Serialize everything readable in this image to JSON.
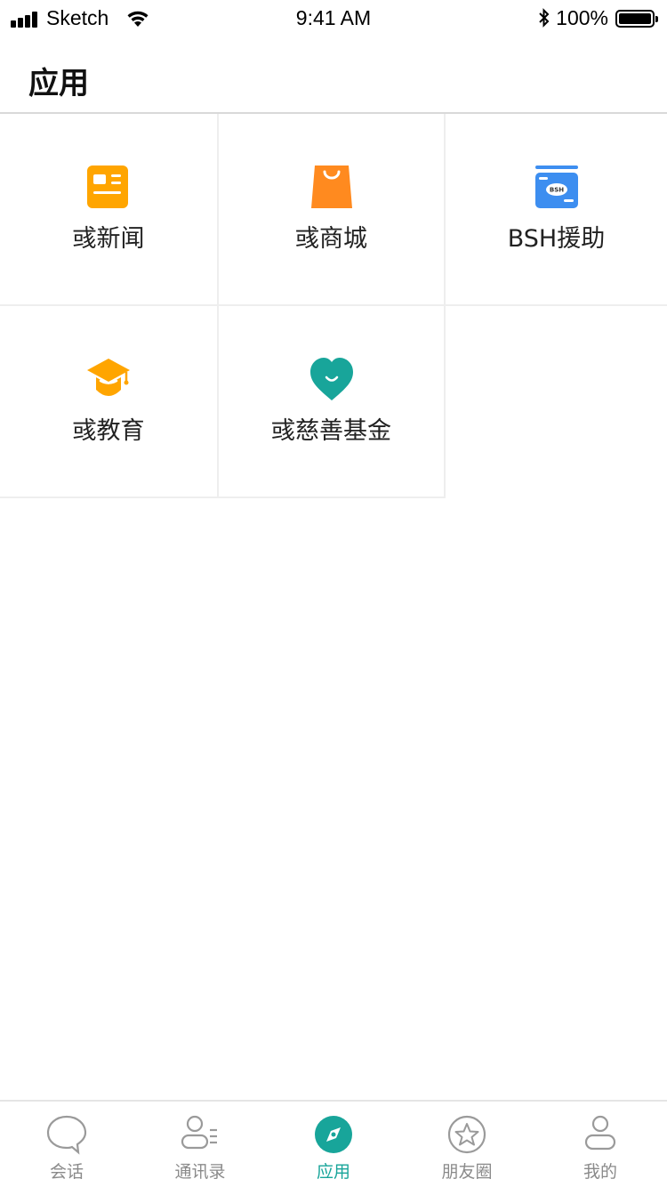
{
  "status_bar": {
    "carrier": "Sketch",
    "time": "9:41 AM",
    "battery": "100%"
  },
  "header": {
    "title": "应用"
  },
  "apps": [
    {
      "label": "彧新闻",
      "icon": "newspaper-icon",
      "color": "#FFA500"
    },
    {
      "label": "彧商城",
      "icon": "shopping-bag-icon",
      "color": "#FF8A1F"
    },
    {
      "label": "BSH援助",
      "icon": "bsh-card-icon",
      "color": "#3D8EF0"
    },
    {
      "label": "彧教育",
      "icon": "graduation-cap-icon",
      "color": "#FFA500"
    },
    {
      "label": "彧慈善基金",
      "icon": "heart-icon",
      "color": "#18A59A"
    }
  ],
  "tabs": [
    {
      "label": "会话",
      "icon": "chat-bubble-icon",
      "active": false
    },
    {
      "label": "通讯录",
      "icon": "contacts-icon",
      "active": false
    },
    {
      "label": "应用",
      "icon": "compass-icon",
      "active": true
    },
    {
      "label": "朋友圈",
      "icon": "star-icon",
      "active": false
    },
    {
      "label": "我的",
      "icon": "person-icon",
      "active": false
    }
  ],
  "colors": {
    "accent": "#18A59A",
    "tab_inactive": "#8A8A8A",
    "divider": "#EEEEEE"
  }
}
